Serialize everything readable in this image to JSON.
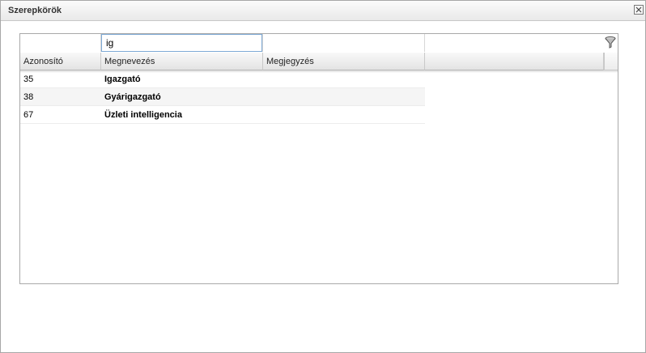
{
  "window": {
    "title": "Szerepkörök"
  },
  "grid": {
    "filters": [
      "",
      "ig",
      ""
    ],
    "columns": [
      "Azonosító",
      "Megnevezés",
      "Megjegyzés"
    ],
    "rows": [
      {
        "id": "35",
        "name": "Igazgató",
        "note": ""
      },
      {
        "id": "38",
        "name": "Gyárigazgató",
        "note": ""
      },
      {
        "id": "67",
        "name": "Üzleti intelligencia",
        "note": ""
      }
    ]
  },
  "icons": {
    "close": "close-icon",
    "filter": "filter-funnel-icon"
  }
}
